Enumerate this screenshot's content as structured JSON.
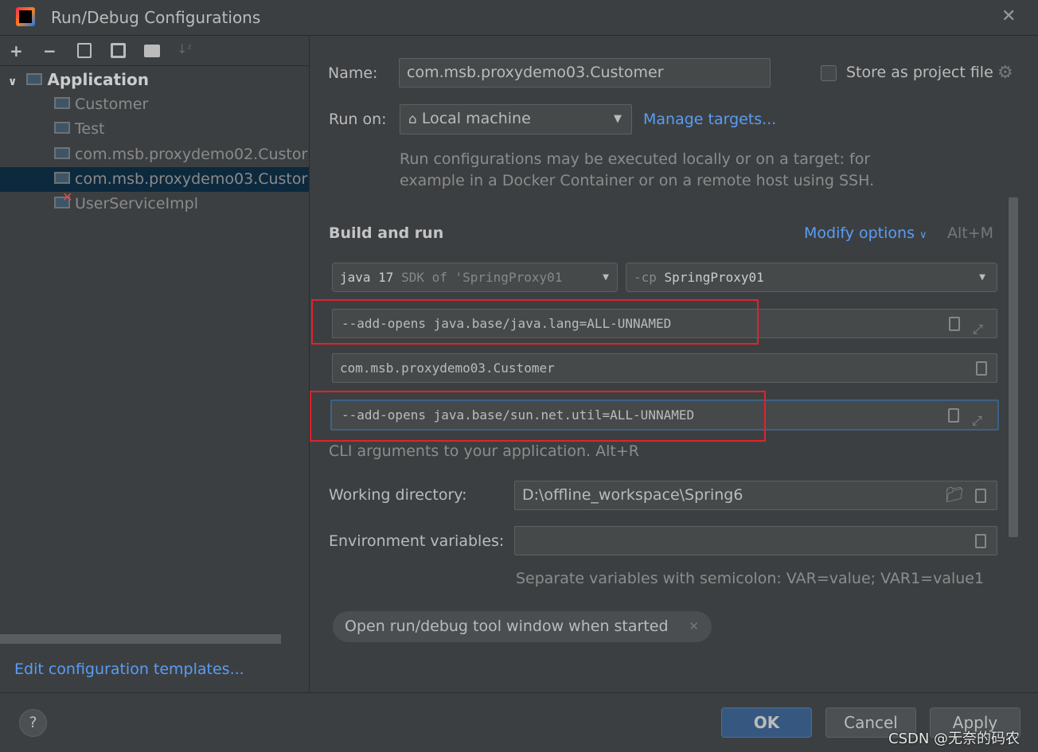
{
  "window": {
    "title": "Run/Debug Configurations"
  },
  "toolbar": {
    "add": "+",
    "remove": "−"
  },
  "tree": {
    "group": "Application",
    "items": [
      {
        "label": "Customer",
        "selected": false
      },
      {
        "label": "Test",
        "selected": false
      },
      {
        "label": "com.msb.proxydemo02.Custor",
        "selected": false
      },
      {
        "label": "com.msb.proxydemo03.Custor",
        "selected": true
      },
      {
        "label": "UserServiceImpl",
        "selected": false,
        "error": true
      }
    ]
  },
  "left_footer": {
    "templates_link": "Edit configuration templates..."
  },
  "form": {
    "name_label": "Name:",
    "name_value": "com.msb.proxydemo03.Customer",
    "store_label": "Store as project file",
    "store_checked": false,
    "run_on_label": "Run on:",
    "run_on_value": "Local machine",
    "manage_targets": "Manage targets...",
    "run_on_desc1": "Run configurations may be executed locally or on a target: for",
    "run_on_desc2": "example in a Docker Container or on a remote host using SSH.",
    "build_run": "Build and run",
    "modify_options": "Modify options",
    "modify_shortcut": "Alt+M",
    "jdk_main": "java 17",
    "jdk_sub": "SDK of 'SpringProxy01",
    "cp_prefix": "-cp",
    "cp_value": "SpringProxy01",
    "vm_options": "--add-opens java.base/java.lang=ALL-UNNAMED",
    "main_class": "com.msb.proxydemo03.Customer",
    "program_args": "--add-opens java.base/sun.net.util=ALL-UNNAMED",
    "args_hint": "CLI arguments to your application. Alt+R",
    "workdir_label": "Working directory:",
    "workdir_value": "D:\\offline_workspace\\Spring6",
    "env_label": "Environment variables:",
    "env_value": "",
    "env_hint": "Separate variables with semicolon: VAR=value; VAR1=value1",
    "chip": "Open run/debug tool window when started"
  },
  "footer": {
    "help": "?",
    "ok": "OK",
    "cancel": "Cancel",
    "apply": "Apply"
  },
  "watermark": "CSDN @无奈的码农",
  "colors": {
    "accent": "#589df6",
    "selection": "#0d293e",
    "highlight_box": "#e0232b",
    "ok_button": "#365880"
  }
}
